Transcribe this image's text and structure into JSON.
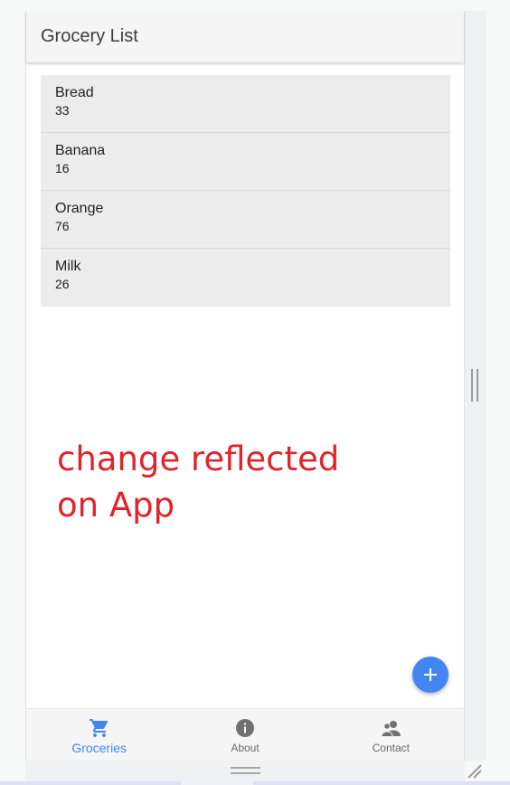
{
  "app": {
    "title": "Grocery List"
  },
  "groceries": [
    {
      "name": "Bread",
      "quantity": "33"
    },
    {
      "name": "Banana",
      "quantity": "16"
    },
    {
      "name": "Orange",
      "quantity": "76"
    },
    {
      "name": "Milk",
      "quantity": "26"
    }
  ],
  "annotation": {
    "line1": "change reflected",
    "line2": "on App"
  },
  "fab": {
    "icon": "plus-icon"
  },
  "bottom_nav": {
    "items": [
      {
        "label": "Groceries",
        "icon": "cart-icon",
        "active": true
      },
      {
        "label": "About",
        "icon": "info-icon",
        "active": false
      },
      {
        "label": "Contact",
        "icon": "contacts-icon",
        "active": false
      }
    ]
  },
  "colors": {
    "accent": "#4285f4",
    "annotation": "#e2232a",
    "list_bg": "#ececec",
    "header_bg": "#f5f5f5"
  }
}
